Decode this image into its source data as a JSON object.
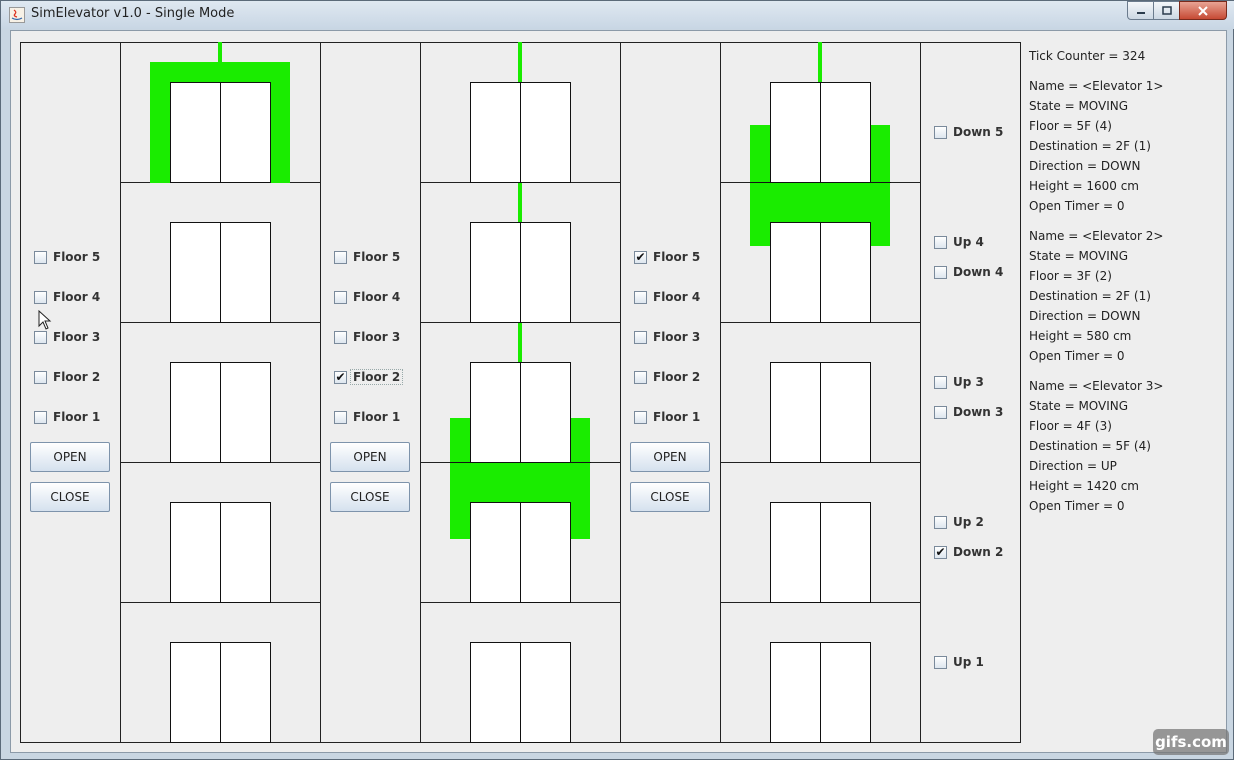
{
  "window": {
    "title": "SimElevator v1.0 - Single Mode"
  },
  "controls": {
    "floor_labels": [
      "Floor 5",
      "Floor 4",
      "Floor 3",
      "Floor 2",
      "Floor 1"
    ],
    "open_label": "OPEN",
    "close_label": "CLOSE",
    "panels": [
      {
        "checked": [
          false,
          false,
          false,
          false,
          false
        ]
      },
      {
        "checked": [
          false,
          false,
          false,
          true,
          false
        ]
      },
      {
        "checked": [
          true,
          false,
          false,
          false,
          false
        ]
      }
    ]
  },
  "hall_calls": [
    {
      "label": "Down 5",
      "checked": false
    },
    {
      "label": "Up 4",
      "checked": false
    },
    {
      "label": "Down 4",
      "checked": false
    },
    {
      "label": "Up 3",
      "checked": false
    },
    {
      "label": "Down 3",
      "checked": false
    },
    {
      "label": "Up 2",
      "checked": false
    },
    {
      "label": "Down 2",
      "checked": true
    },
    {
      "label": "Up 1",
      "checked": false
    }
  ],
  "status": {
    "tick_counter": "Tick Counter = 324",
    "elevators": [
      {
        "name": "Name = <Elevator 1>",
        "state": "State = MOVING",
        "floor": "Floor = 5F (4)",
        "destination": "Destination = 2F (1)",
        "direction": "Direction = DOWN",
        "height": "Height = 1600 cm",
        "open_timer": "Open Timer = 0"
      },
      {
        "name": "Name = <Elevator 2>",
        "state": "State = MOVING",
        "floor": "Floor = 3F (2)",
        "destination": "Destination = 2F (1)",
        "direction": "Direction = DOWN",
        "height": "Height = 580 cm",
        "open_timer": "Open Timer = 0"
      },
      {
        "name": "Name = <Elevator 3>",
        "state": "State = MOVING",
        "floor": "Floor = 4F (3)",
        "destination": "Destination = 5F (4)",
        "direction": "Direction = UP",
        "height": "Height = 1420 cm",
        "open_timer": "Open Timer = 0"
      }
    ]
  },
  "shaft_color": "#1aec00",
  "watermark": "gifs.com"
}
